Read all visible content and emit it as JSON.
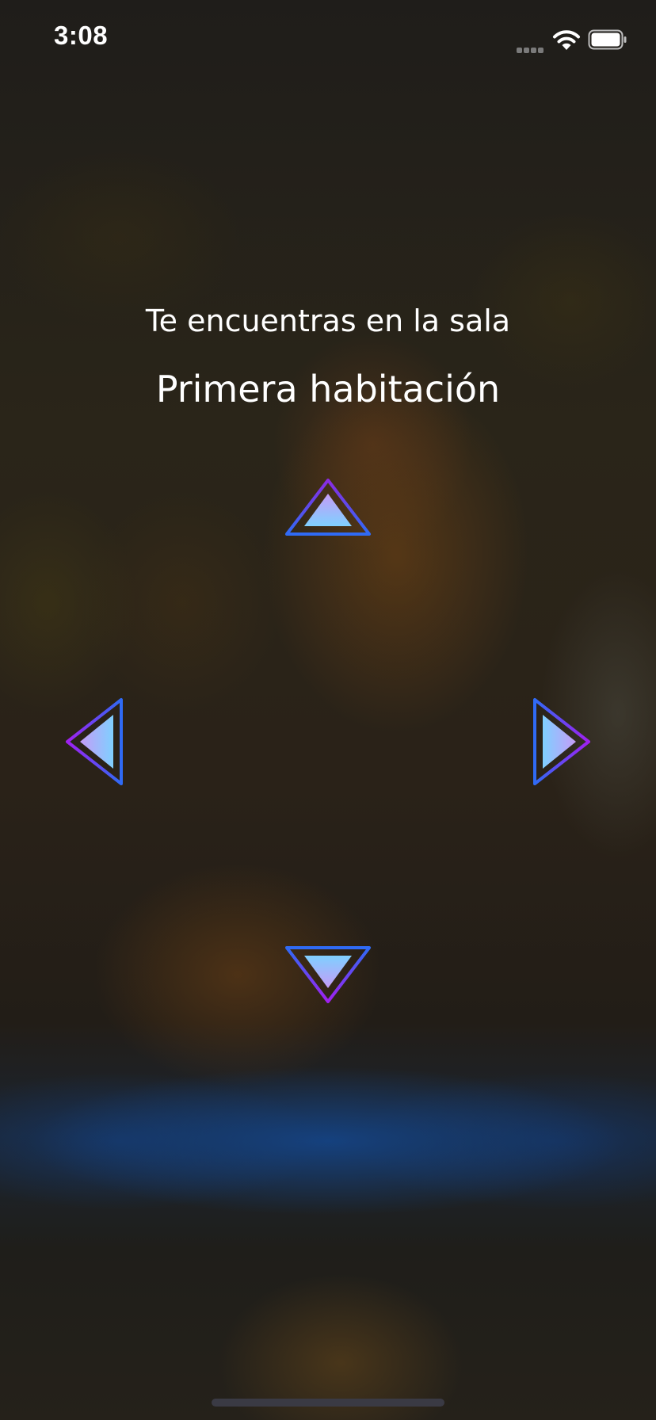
{
  "status_bar": {
    "time": "3:08",
    "signal_icon": "cellular-signal-icon",
    "wifi_icon": "wifi-icon",
    "battery_icon": "battery-icon"
  },
  "main": {
    "subtitle": "Te encuentras en la sala",
    "room_name": "Primera habitación"
  },
  "navigation": {
    "up_icon": "arrow-up-icon",
    "down_icon": "arrow-down-icon",
    "left_icon": "arrow-left-icon",
    "right_icon": "arrow-right-icon"
  },
  "colors": {
    "arrow_border_start": "#7a2bf0",
    "arrow_border_end": "#2f6bf5",
    "arrow_fill_start": "#7fd0ff",
    "arrow_fill_end": "#c59cf7",
    "text": "#ffffff"
  }
}
